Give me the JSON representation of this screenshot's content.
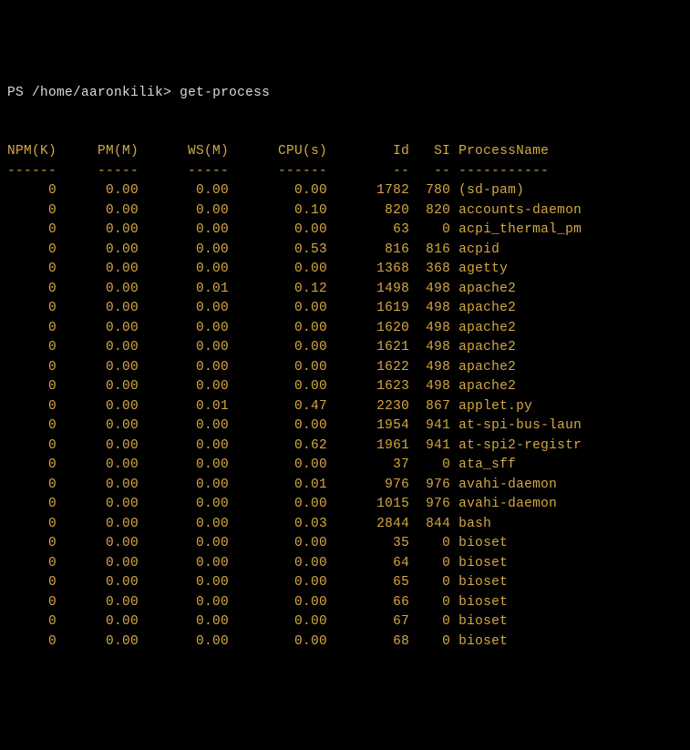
{
  "prompt": {
    "ps": "PS",
    "path": "/home/aaronkilik",
    "arrow": ">",
    "command": "get-process"
  },
  "columns": [
    "NPM(K)",
    "PM(M)",
    "WS(M)",
    "CPU(s)",
    "Id",
    "SI",
    "ProcessName"
  ],
  "dividers": [
    "------",
    "-----",
    "-----",
    "------",
    "--",
    "--",
    "-----------"
  ],
  "rows": [
    {
      "npm": "0",
      "pm": "0.00",
      "ws": "0.00",
      "cpu": "0.00",
      "id": "1782",
      "si": "780",
      "name": "(sd-pam)"
    },
    {
      "npm": "0",
      "pm": "0.00",
      "ws": "0.00",
      "cpu": "0.10",
      "id": "820",
      "si": "820",
      "name": "accounts-daemon"
    },
    {
      "npm": "0",
      "pm": "0.00",
      "ws": "0.00",
      "cpu": "0.00",
      "id": "63",
      "si": "0",
      "name": "acpi_thermal_pm"
    },
    {
      "npm": "0",
      "pm": "0.00",
      "ws": "0.00",
      "cpu": "0.53",
      "id": "816",
      "si": "816",
      "name": "acpid"
    },
    {
      "npm": "0",
      "pm": "0.00",
      "ws": "0.00",
      "cpu": "0.00",
      "id": "1368",
      "si": "368",
      "name": "agetty"
    },
    {
      "npm": "0",
      "pm": "0.00",
      "ws": "0.01",
      "cpu": "0.12",
      "id": "1498",
      "si": "498",
      "name": "apache2"
    },
    {
      "npm": "0",
      "pm": "0.00",
      "ws": "0.00",
      "cpu": "0.00",
      "id": "1619",
      "si": "498",
      "name": "apache2"
    },
    {
      "npm": "0",
      "pm": "0.00",
      "ws": "0.00",
      "cpu": "0.00",
      "id": "1620",
      "si": "498",
      "name": "apache2"
    },
    {
      "npm": "0",
      "pm": "0.00",
      "ws": "0.00",
      "cpu": "0.00",
      "id": "1621",
      "si": "498",
      "name": "apache2"
    },
    {
      "npm": "0",
      "pm": "0.00",
      "ws": "0.00",
      "cpu": "0.00",
      "id": "1622",
      "si": "498",
      "name": "apache2"
    },
    {
      "npm": "0",
      "pm": "0.00",
      "ws": "0.00",
      "cpu": "0.00",
      "id": "1623",
      "si": "498",
      "name": "apache2"
    },
    {
      "npm": "0",
      "pm": "0.00",
      "ws": "0.01",
      "cpu": "0.47",
      "id": "2230",
      "si": "867",
      "name": "applet.py"
    },
    {
      "npm": "0",
      "pm": "0.00",
      "ws": "0.00",
      "cpu": "0.00",
      "id": "1954",
      "si": "941",
      "name": "at-spi-bus-laun"
    },
    {
      "npm": "0",
      "pm": "0.00",
      "ws": "0.00",
      "cpu": "0.62",
      "id": "1961",
      "si": "941",
      "name": "at-spi2-registr"
    },
    {
      "npm": "0",
      "pm": "0.00",
      "ws": "0.00",
      "cpu": "0.00",
      "id": "37",
      "si": "0",
      "name": "ata_sff"
    },
    {
      "npm": "0",
      "pm": "0.00",
      "ws": "0.00",
      "cpu": "0.01",
      "id": "976",
      "si": "976",
      "name": "avahi-daemon"
    },
    {
      "npm": "0",
      "pm": "0.00",
      "ws": "0.00",
      "cpu": "0.00",
      "id": "1015",
      "si": "976",
      "name": "avahi-daemon"
    },
    {
      "npm": "0",
      "pm": "0.00",
      "ws": "0.00",
      "cpu": "0.03",
      "id": "2844",
      "si": "844",
      "name": "bash"
    },
    {
      "npm": "0",
      "pm": "0.00",
      "ws": "0.00",
      "cpu": "0.00",
      "id": "35",
      "si": "0",
      "name": "bioset"
    },
    {
      "npm": "0",
      "pm": "0.00",
      "ws": "0.00",
      "cpu": "0.00",
      "id": "64",
      "si": "0",
      "name": "bioset"
    },
    {
      "npm": "0",
      "pm": "0.00",
      "ws": "0.00",
      "cpu": "0.00",
      "id": "65",
      "si": "0",
      "name": "bioset"
    },
    {
      "npm": "0",
      "pm": "0.00",
      "ws": "0.00",
      "cpu": "0.00",
      "id": "66",
      "si": "0",
      "name": "bioset"
    },
    {
      "npm": "0",
      "pm": "0.00",
      "ws": "0.00",
      "cpu": "0.00",
      "id": "67",
      "si": "0",
      "name": "bioset"
    },
    {
      "npm": "0",
      "pm": "0.00",
      "ws": "0.00",
      "cpu": "0.00",
      "id": "68",
      "si": "0",
      "name": "bioset"
    }
  ],
  "chart_data": {
    "type": "table",
    "title": "get-process output",
    "columns": [
      "NPM(K)",
      "PM(M)",
      "WS(M)",
      "CPU(s)",
      "Id",
      "SI",
      "ProcessName"
    ],
    "data": [
      [
        0,
        0.0,
        0.0,
        0.0,
        1782,
        780,
        "(sd-pam)"
      ],
      [
        0,
        0.0,
        0.0,
        0.1,
        820,
        820,
        "accounts-daemon"
      ],
      [
        0,
        0.0,
        0.0,
        0.0,
        63,
        0,
        "acpi_thermal_pm"
      ],
      [
        0,
        0.0,
        0.0,
        0.53,
        816,
        816,
        "acpid"
      ],
      [
        0,
        0.0,
        0.0,
        0.0,
        1368,
        368,
        "agetty"
      ],
      [
        0,
        0.0,
        0.01,
        0.12,
        1498,
        498,
        "apache2"
      ],
      [
        0,
        0.0,
        0.0,
        0.0,
        1619,
        498,
        "apache2"
      ],
      [
        0,
        0.0,
        0.0,
        0.0,
        1620,
        498,
        "apache2"
      ],
      [
        0,
        0.0,
        0.0,
        0.0,
        1621,
        498,
        "apache2"
      ],
      [
        0,
        0.0,
        0.0,
        0.0,
        1622,
        498,
        "apache2"
      ],
      [
        0,
        0.0,
        0.0,
        0.0,
        1623,
        498,
        "apache2"
      ],
      [
        0,
        0.0,
        0.01,
        0.47,
        2230,
        867,
        "applet.py"
      ],
      [
        0,
        0.0,
        0.0,
        0.0,
        1954,
        941,
        "at-spi-bus-laun"
      ],
      [
        0,
        0.0,
        0.0,
        0.62,
        1961,
        941,
        "at-spi2-registr"
      ],
      [
        0,
        0.0,
        0.0,
        0.0,
        37,
        0,
        "ata_sff"
      ],
      [
        0,
        0.0,
        0.0,
        0.01,
        976,
        976,
        "avahi-daemon"
      ],
      [
        0,
        0.0,
        0.0,
        0.0,
        1015,
        976,
        "avahi-daemon"
      ],
      [
        0,
        0.0,
        0.0,
        0.03,
        2844,
        844,
        "bash"
      ],
      [
        0,
        0.0,
        0.0,
        0.0,
        35,
        0,
        "bioset"
      ],
      [
        0,
        0.0,
        0.0,
        0.0,
        64,
        0,
        "bioset"
      ],
      [
        0,
        0.0,
        0.0,
        0.0,
        65,
        0,
        "bioset"
      ],
      [
        0,
        0.0,
        0.0,
        0.0,
        66,
        0,
        "bioset"
      ],
      [
        0,
        0.0,
        0.0,
        0.0,
        67,
        0,
        "bioset"
      ],
      [
        0,
        0.0,
        0.0,
        0.0,
        68,
        0,
        "bioset"
      ]
    ]
  }
}
